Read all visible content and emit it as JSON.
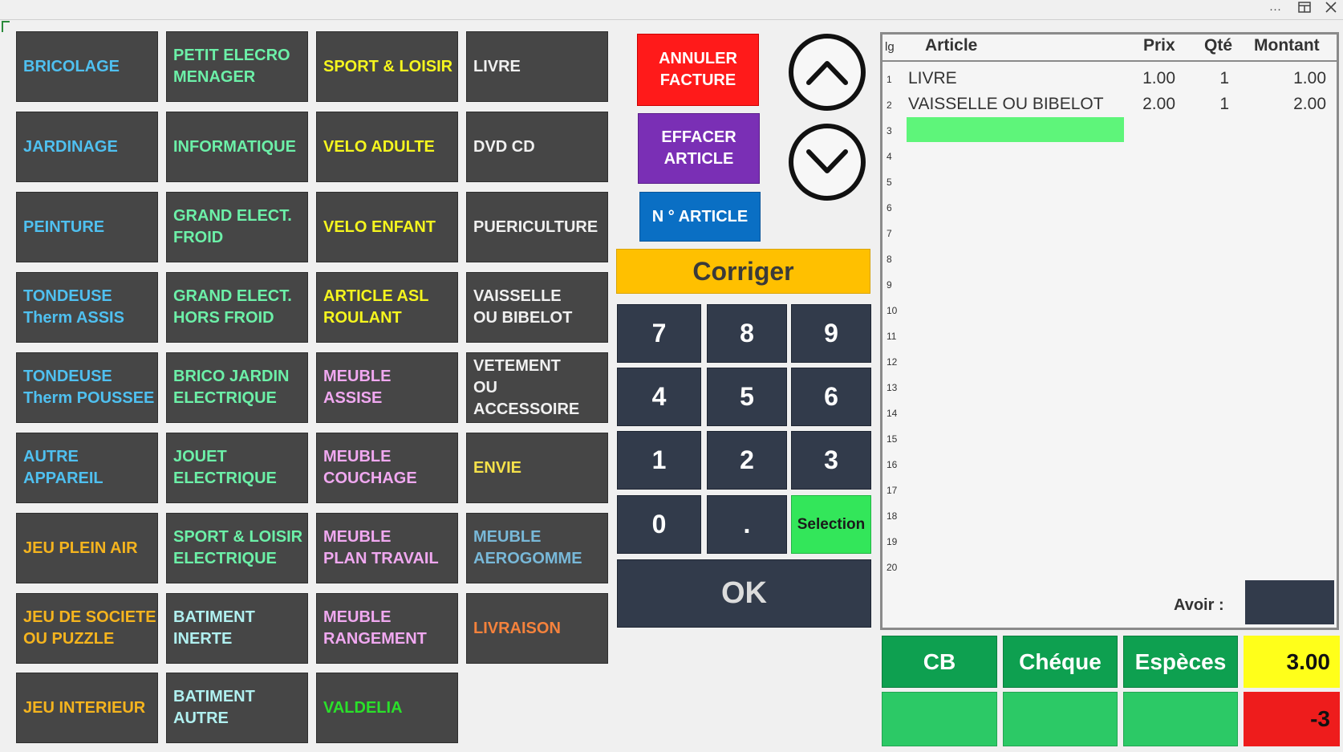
{
  "titlebar": {
    "more_icon": "more-icon",
    "restore_icon": "restore-icon",
    "close_icon": "close-icon"
  },
  "categories": [
    {
      "label": "BRICOLAGE",
      "color": "#4fc0f0"
    },
    {
      "label": "JARDINAGE",
      "color": "#4fc0f0"
    },
    {
      "label": "PEINTURE",
      "color": "#4fc0f0"
    },
    {
      "label": "TONDEUSE\nTherm  ASSIS",
      "color": "#4fc0f0"
    },
    {
      "label": "TONDEUSE\nTherm POUSSEE",
      "color": "#4fc0f0"
    },
    {
      "label": "AUTRE\nAPPAREIL",
      "color": "#4fc0f0"
    },
    {
      "label": "JEU PLEIN  AIR",
      "color": "#f5b41e"
    },
    {
      "label": "JEU DE SOCIETE\nOU PUZZLE",
      "color": "#f5b41e"
    },
    {
      "label": "JEU INTERIEUR",
      "color": "#f5b41e"
    },
    {
      "label": "PETIT ELECRO\nMENAGER",
      "color": "#6cf0a8"
    },
    {
      "label": "INFORMATIQUE",
      "color": "#6cf0a8"
    },
    {
      "label": "GRAND ELECT.\nFROID",
      "color": "#6cf0a8"
    },
    {
      "label": "GRAND ELECT.\nHORS FROID",
      "color": "#6cf0a8"
    },
    {
      "label": "BRICO JARDIN\nELECTRIQUE",
      "color": "#6cf0a8"
    },
    {
      "label": "JOUET\nELECTRIQUE",
      "color": "#6cf0a8"
    },
    {
      "label": "SPORT & LOISIR\nELECTRIQUE",
      "color": "#6cf0a8"
    },
    {
      "label": "BATIMENT\nINERTE",
      "color": "#b0f0f0"
    },
    {
      "label": "BATIMENT\nAUTRE",
      "color": "#b0f0f0"
    },
    {
      "label": "SPORT  & LOISIR",
      "color": "#f5f51e"
    },
    {
      "label": "VELO ADULTE",
      "color": "#f5f51e"
    },
    {
      "label": "VELO ENFANT",
      "color": "#f5f51e"
    },
    {
      "label": "ARTICLE ASL\nROULANT",
      "color": "#f5f51e"
    },
    {
      "label": "MEUBLE\nASSISE",
      "color": "#f0a8f0"
    },
    {
      "label": "MEUBLE\nCOUCHAGE",
      "color": "#f0a8f0"
    },
    {
      "label": "MEUBLE\nPLAN TRAVAIL",
      "color": "#f0a8f0"
    },
    {
      "label": "MEUBLE\nRANGEMENT",
      "color": "#f0a8f0"
    },
    {
      "label": "VALDELIA",
      "color": "#2ae02a"
    },
    {
      "label": "LIVRE",
      "color": "#f0f0f0"
    },
    {
      "label": "DVD  CD",
      "color": "#f0f0f0"
    },
    {
      "label": "PUERICULTURE",
      "color": "#f0f0f0"
    },
    {
      "label": "VAISSELLE\nOU BIBELOT",
      "color": "#f0f0f0"
    },
    {
      "label": "VETEMENT\nOU ACCESSOIRE",
      "color": "#f0f0f0"
    },
    {
      "label": "ENVIE",
      "color": "#f5e14a"
    },
    {
      "label": "MEUBLE\nAEROGOMME",
      "color": "#78b8d8"
    },
    {
      "label": "LIVRAISON",
      "color": "#f5823c"
    }
  ],
  "actions": {
    "annuler": "ANNULER\nFACTURE",
    "effacer": "EFFACER\nARTICLE",
    "narticle": "N ° ARTICLE",
    "corriger": "Corriger",
    "ok": "OK",
    "selection": "Selection",
    "scroll_up_icon": "chevron-up-icon",
    "scroll_down_icon": "chevron-down-icon"
  },
  "colors": {
    "annuler": "#ff1a1a",
    "effacer": "#7a2fb5",
    "narticle": "#0a6fc4",
    "corriger": "#ffc000",
    "key": "#323b4b",
    "selection": "#33e65a"
  },
  "keypad": [
    "7",
    "8",
    "9",
    "4",
    "5",
    "6",
    "1",
    "2",
    "3",
    "0",
    "."
  ],
  "invoice": {
    "headers": {
      "lg": "lg",
      "article": "Article",
      "prix": "Prix",
      "qte": "Qté",
      "montant": "Montant"
    },
    "line_numbers": [
      "1",
      "2",
      "3",
      "4",
      "5",
      "6",
      "7",
      "8",
      "9",
      "10",
      "11",
      "12",
      "13",
      "14",
      "15",
      "16",
      "17",
      "18",
      "19",
      "20"
    ],
    "lines": [
      {
        "article": "LIVRE",
        "prix": "1.00",
        "qte": "1",
        "montant": "1.00"
      },
      {
        "article": "VAISSELLE OU BIBELOT",
        "prix": "2.00",
        "qte": "1",
        "montant": "2.00"
      }
    ],
    "avoir_label": "Avoir :",
    "avoir_value": ""
  },
  "payment": {
    "cb": "CB",
    "cheque": "Chéque",
    "especes": "Espèces",
    "total": "3.00",
    "balance": "-3"
  }
}
